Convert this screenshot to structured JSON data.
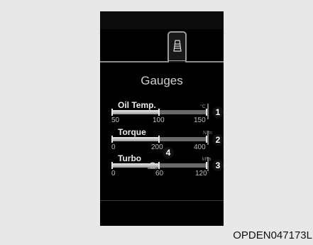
{
  "screen": {
    "title": "Gauges",
    "tab_icon": "gauges-tab-icon"
  },
  "gauges": [
    {
      "label": "Oil Temp.",
      "unit": "°C",
      "ticks": [
        "50",
        "100",
        "150"
      ],
      "fill": 0.5
    },
    {
      "label": "Torque",
      "unit": "N.m",
      "ticks": [
        "0",
        "200",
        "400"
      ],
      "fill": 0.5
    },
    {
      "label": "Turbo",
      "unit": "kPa",
      "ticks": [
        "0",
        "60",
        "120"
      ],
      "fill": 0.5
    }
  ],
  "callouts": [
    "1",
    "2",
    "3",
    "4"
  ],
  "caption": "OPDEN047173L"
}
